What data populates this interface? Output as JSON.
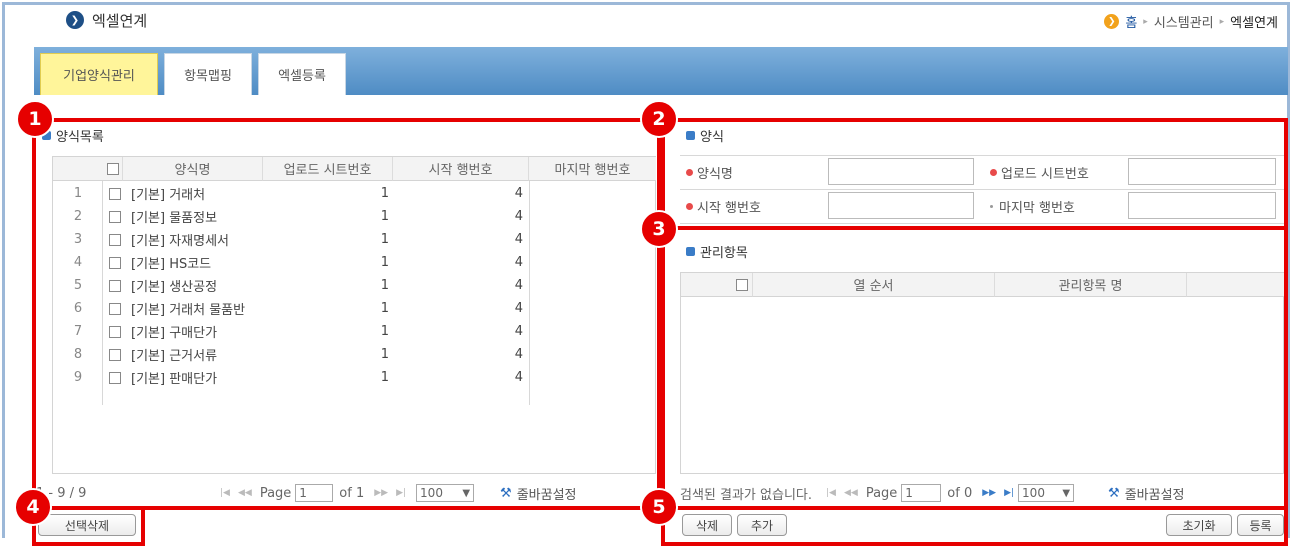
{
  "page_title": "엑셀연계",
  "breadcrumb": {
    "home": "홈",
    "level1": "시스템관리",
    "current": "엑셀연계"
  },
  "tabs": [
    {
      "label": "기업양식관리"
    },
    {
      "label": "항목맵핑"
    },
    {
      "label": "엑셀등록"
    }
  ],
  "badges": [
    "1",
    "2",
    "3",
    "4",
    "5"
  ],
  "form_list": {
    "title": "양식목록",
    "columns": [
      "양식명",
      "업로드 시트번호",
      "시작 행번호",
      "마지막 행번호"
    ],
    "rows": [
      {
        "no": "1",
        "name": "[기본] 거래처",
        "sheet": "1",
        "start": "4"
      },
      {
        "no": "2",
        "name": "[기본] 물품정보",
        "sheet": "1",
        "start": "4"
      },
      {
        "no": "3",
        "name": "[기본] 자재명세서",
        "sheet": "1",
        "start": "4"
      },
      {
        "no": "4",
        "name": "[기본] HS코드",
        "sheet": "1",
        "start": "4"
      },
      {
        "no": "5",
        "name": "[기본] 생산공정",
        "sheet": "1",
        "start": "4"
      },
      {
        "no": "6",
        "name": "[기본] 거래처 물품반",
        "sheet": "1",
        "start": "4"
      },
      {
        "no": "7",
        "name": "[기본] 구매단가",
        "sheet": "1",
        "start": "4"
      },
      {
        "no": "8",
        "name": "[기본] 근거서류",
        "sheet": "1",
        "start": "4"
      },
      {
        "no": "9",
        "name": "[기본] 판매단가",
        "sheet": "1",
        "start": "4"
      }
    ],
    "pager": {
      "range": "1 - 9 / 9",
      "page_label": "Page",
      "page": "1",
      "of": "of 1",
      "size": "100",
      "wrap": "줄바꿈설정"
    }
  },
  "form": {
    "title": "양식",
    "name_label": "양식명",
    "sheet_label": "업로드 시트번호",
    "start_label": "시작 행번호",
    "end_label": "마지막 행번호"
  },
  "items": {
    "title": "관리항목",
    "columns": [
      "열 순서",
      "관리항목 명"
    ],
    "pager": {
      "empty": "검색된 결과가 없습니다.",
      "page_label": "Page",
      "page": "1",
      "of": "of 0",
      "size": "100",
      "wrap": "줄바꿈설정"
    }
  },
  "buttons": {
    "delete_selected": "선택삭제",
    "delete": "삭제",
    "add": "추가",
    "reset": "초기화",
    "register": "등록"
  }
}
